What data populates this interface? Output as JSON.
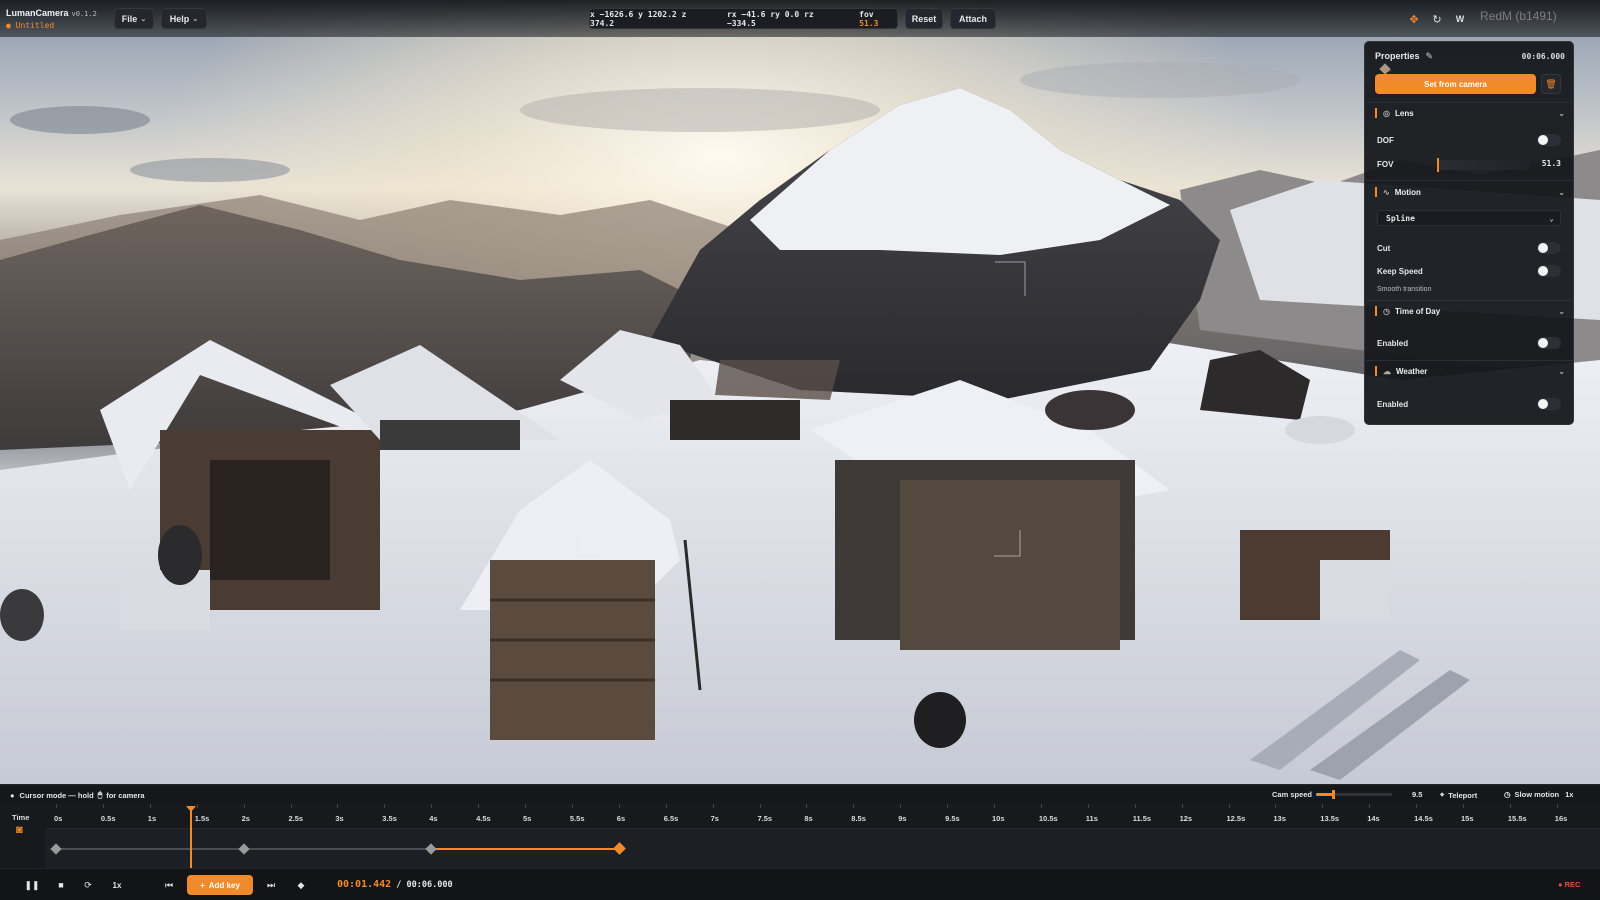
{
  "app": {
    "name": "LumanCamera",
    "version": "v0.1.2",
    "file": "● Untitled"
  },
  "toolbar": {
    "file_label": "File",
    "help_label": "Help",
    "coords": {
      "pos": "x −1626.6 y 1202.2 z 374.2",
      "rot": "rx −41.6 ry 0.0 rz −334.5",
      "fov_label": "fov",
      "fov_value": "51.3"
    },
    "reset_label": "Reset",
    "attach_label": "Attach",
    "mode_w_label": "W",
    "watermark": "RedM (b1491)"
  },
  "properties": {
    "title": "Properties",
    "keyframe_id": "kf_34",
    "time": "00:06.000",
    "set_from_camera_label": "Set from camera",
    "sections": {
      "lens": {
        "title": "Lens",
        "dof_label": "DOF",
        "dof_on": false,
        "fov_label": "FOV",
        "fov_value": "51.3",
        "fov_fraction": 0.0
      },
      "motion": {
        "title": "Motion",
        "interp_value": "Spline",
        "cut_label": "Cut",
        "cut_on": false,
        "keep_speed_label": "Keep Speed",
        "keep_speed_on": false,
        "hint": "Smooth transition"
      },
      "time_of_day": {
        "title": "Time of Day",
        "enabled_label": "Enabled",
        "enabled_on": false
      },
      "weather": {
        "title": "Weather",
        "enabled_label": "Enabled",
        "enabled_on": false
      }
    }
  },
  "statusbar": {
    "cursor_mode_a": "Cursor mode — hold",
    "cursor_mode_b": "for camera",
    "cam_speed_label": "Cam speed",
    "cam_speed_value": "9.5",
    "cam_speed_fraction": 0.22,
    "teleport_label": "Teleport",
    "slow_motion_label": "Slow motion",
    "slow_motion_value": "1x"
  },
  "timeline": {
    "time_label": "Time",
    "ticks": [
      "0s",
      "0.5s",
      "1s",
      "1.5s",
      "2s",
      "2.5s",
      "3s",
      "3.5s",
      "4s",
      "4.5s",
      "5s",
      "5.5s",
      "6s",
      "6.5s",
      "7s",
      "7.5s",
      "8s",
      "8.5s",
      "9s",
      "9.5s",
      "10s",
      "10.5s",
      "11s",
      "11.5s",
      "12s",
      "12.5s",
      "13s",
      "13.5s",
      "14s",
      "14.5s",
      "15s",
      "15.5s",
      "16s"
    ],
    "keyframes_s": [
      0,
      2,
      4,
      6
    ],
    "active_keyframe_s": 6,
    "playhead_s": 1.442
  },
  "transport": {
    "speed_label": "1x",
    "add_key_label": "Add key",
    "current_time": "00:01.442",
    "separator": " / ",
    "total_time": "00:06.000",
    "rec_label": "REC"
  },
  "colors": {
    "accent": "#f08a2a",
    "rec": "#e0533d"
  }
}
